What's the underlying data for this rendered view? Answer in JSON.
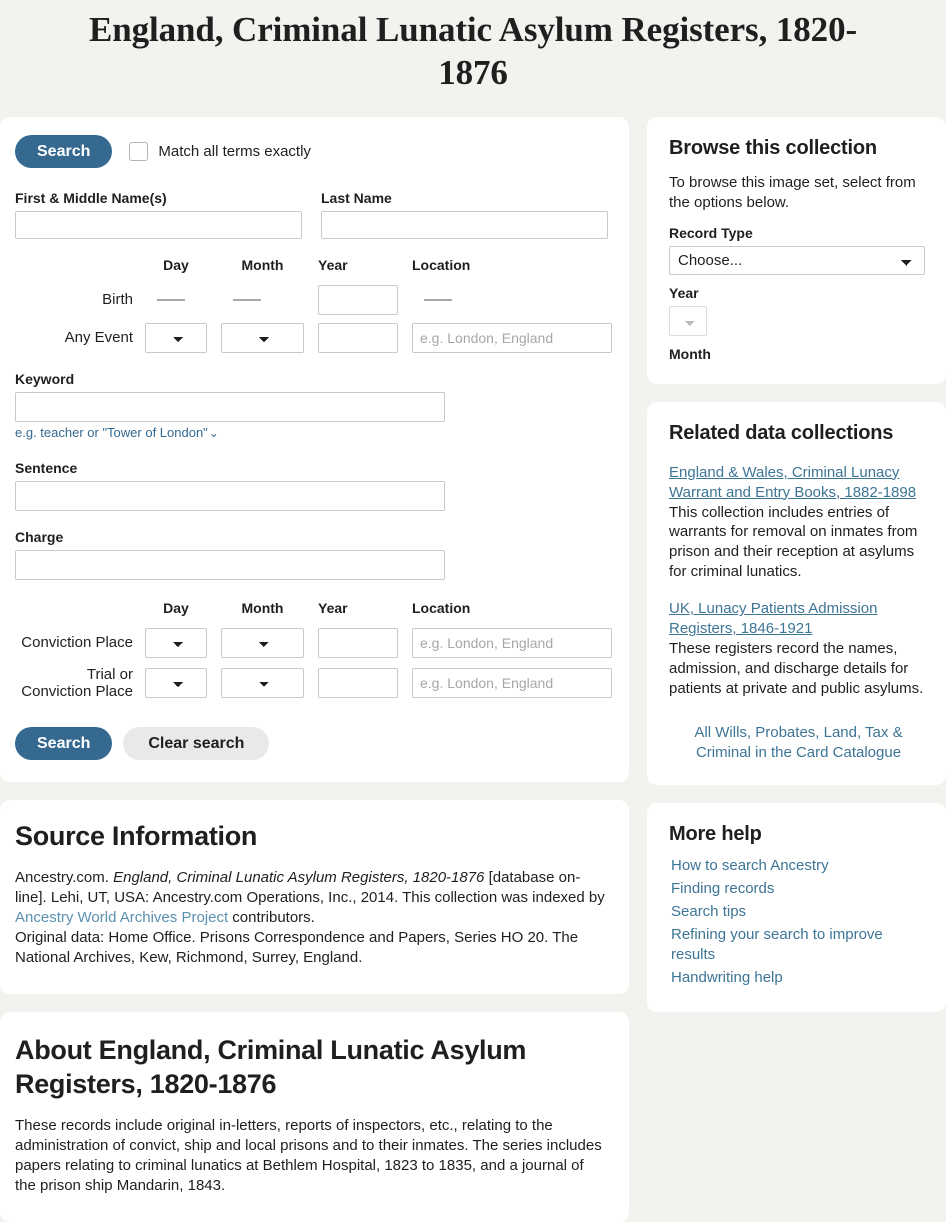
{
  "header": {
    "title": "England, Criminal Lunatic Asylum Registers, 1820-1876"
  },
  "search_form": {
    "search_button_top": "Search",
    "match_exactly_label": "Match all terms exactly",
    "first_name_label": "First & Middle Name(s)",
    "first_name_value": "",
    "last_name_label": "Last Name",
    "last_name_value": "",
    "col_day": "Day",
    "col_month": "Month",
    "col_year": "Year",
    "col_location": "Location",
    "birth_label": "Birth",
    "birth_year_value": "",
    "any_event_label": "Any Event",
    "any_event_year_value": "",
    "location_placeholder": "e.g. London, England",
    "keyword_label": "Keyword",
    "keyword_value": "",
    "keyword_hint": "e.g. teacher or \"Tower of London\"",
    "sentence_label": "Sentence",
    "sentence_value": "",
    "charge_label": "Charge",
    "charge_value": "",
    "conviction_place_label": "Conviction Place",
    "conviction_year_value": "",
    "trial_or_conviction_place_label": "Trial or Conviction Place",
    "trial_year_value": "",
    "search_button": "Search",
    "clear_button": "Clear search",
    "day_selected": "",
    "month_selected": ""
  },
  "source_information": {
    "title": "Source Information",
    "line1_prefix": "Ancestry.com. ",
    "line1_italic": "England, Criminal Lunatic Asylum Registers, 1820-1876",
    "line1_suffix": " [database on-line]. Lehi, UT, USA: Ancestry.com Operations, Inc., 2014. This collection was indexed by ",
    "line1_link": "Ancestry World Archives Project",
    "line1_tail": " contributors.",
    "line2": "Original data: Home Office. Prisons Correspondence and Papers, Series HO 20. The National Archives, Kew, Richmond, Surrey, England."
  },
  "about": {
    "title": "About England, Criminal Lunatic Asylum Registers, 1820-1876",
    "text": "These records include original in-letters, reports of inspectors, etc., relating to the administration of convict, ship and local prisons and to their inmates. The series includes papers relating to criminal lunatics at Bethlem Hospital, 1823 to 1835, and a journal of the prison ship Mandarin, 1843."
  },
  "browse": {
    "title": "Browse this collection",
    "intro": "To browse this image set, select from the options below.",
    "record_type_label": "Record Type",
    "record_type_value": "Choose...",
    "year_label": "Year",
    "year_value": "",
    "month_label": "Month"
  },
  "related": {
    "title": "Related data collections",
    "items": [
      {
        "link": "England & Wales, Criminal Lunacy Warrant and Entry Books, 1882-1898",
        "desc": "This collection includes entries of warrants for removal on inmates from prison and their reception at asylums for criminal lunatics."
      },
      {
        "link": "UK, Lunacy Patients Admission Registers, 1846-1921",
        "desc": "These registers record the names, admission, and discharge details for patients at private and public asylums."
      }
    ],
    "catalogue_link": "All Wills, Probates, Land, Tax & Criminal in the Card Catalogue"
  },
  "more_help": {
    "title": "More help",
    "links": [
      "How to search Ancestry",
      "Finding records",
      "Search tips",
      "Refining your search to improve results",
      "Handwriting help"
    ]
  },
  "colors": {
    "accent": "#35698f",
    "link": "#3d7595",
    "page_bg": "#f3f2ef",
    "card_bg": "#ffffff"
  }
}
